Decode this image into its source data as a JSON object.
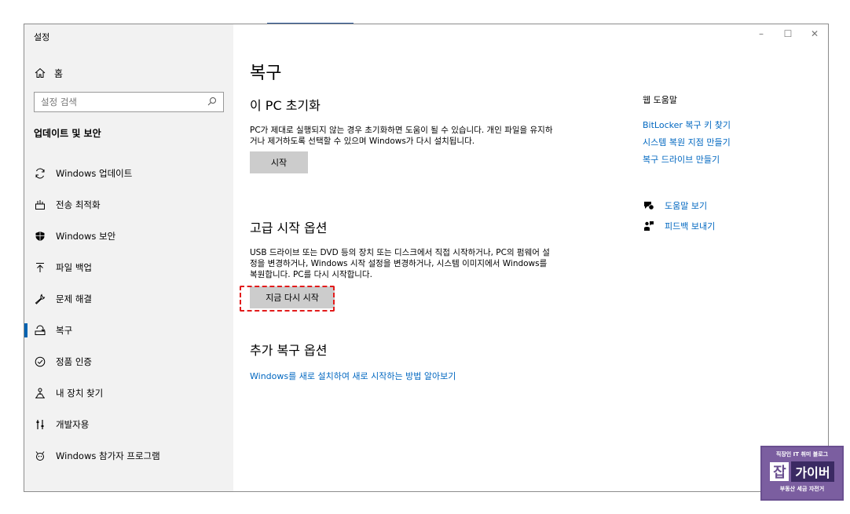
{
  "window": {
    "app_title": "설정",
    "controls": {
      "minimize": "–",
      "maximize": "☐",
      "close": "✕"
    }
  },
  "sidebar": {
    "home_label": "홈",
    "search_placeholder": "설정 검색",
    "section_title": "업데이트 및 보안",
    "items": [
      {
        "label": "Windows 업데이트",
        "icon": "sync-icon"
      },
      {
        "label": "전송 최적화",
        "icon": "delivery-optimization-icon"
      },
      {
        "label": "Windows 보안",
        "icon": "shield-icon"
      },
      {
        "label": "파일 백업",
        "icon": "backup-icon"
      },
      {
        "label": "문제 해결",
        "icon": "wrench-icon"
      },
      {
        "label": "복구",
        "icon": "recovery-icon",
        "active": true
      },
      {
        "label": "정품 인증",
        "icon": "check-circle-icon"
      },
      {
        "label": "내 장치 찾기",
        "icon": "find-device-icon"
      },
      {
        "label": "개발자용",
        "icon": "developer-icon"
      },
      {
        "label": "Windows 참가자 프로그램",
        "icon": "insider-icon"
      }
    ]
  },
  "main": {
    "title": "복구",
    "reset": {
      "heading": "이 PC 초기화",
      "description": "PC가 제대로 실행되지 않는 경우 초기화하면 도움이 될 수 있습니다. 개인 파일을 유지하거나 제거하도록 선택할 수 있으며 Windows가 다시 설치됩니다.",
      "button": "시작"
    },
    "advanced": {
      "heading": "고급 시작 옵션",
      "description": "USB 드라이브 또는 DVD 등의 장치 또는 디스크에서 직접 시작하거나, PC의 펌웨어 설정을 변경하거나, Windows 시작 설정을 변경하거나, 시스템 이미지에서 Windows를 복원합니다. PC를 다시 시작합니다.",
      "button": "지금 다시 시작"
    },
    "more": {
      "heading": "추가 복구 옵션",
      "link": "Windows를 새로 설치하여 새로 시작하는 방법 알아보기"
    }
  },
  "help_panel": {
    "heading": "웹 도움말",
    "links": [
      "BitLocker 복구 키 찾기",
      "시스템 복원 지점 만들기",
      "복구 드라이브 만들기"
    ],
    "get_help": "도움말 보기",
    "feedback": "피드백 보내기"
  },
  "watermark": {
    "top": "직장인 IT 취미 블로그",
    "char": "잡",
    "word": "가이버",
    "bottom": "부동산 세금 자전거"
  },
  "colors": {
    "accent": "#0063b1",
    "link": "#0067c0",
    "highlight": "#e21b1b",
    "sidebar_bg": "#f2f2f2"
  }
}
